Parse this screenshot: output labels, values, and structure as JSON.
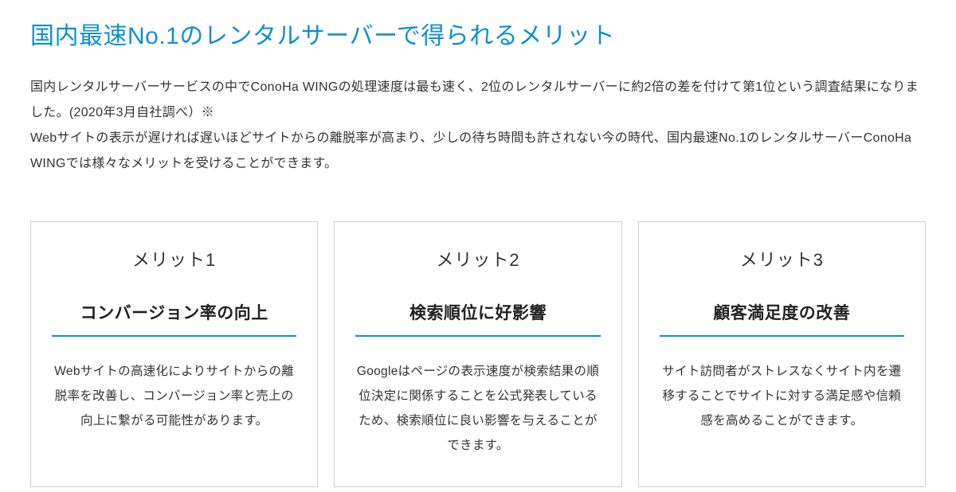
{
  "heading": "国内最速No.1のレンタルサーバーで得られるメリット",
  "intro": "国内レンタルサーバーサービスの中でConoHa WINGの処理速度は最も速く、2位のレンタルサーバーに約2倍の差を付けて第1位という調査結果になりました。(2020年3月自社調べ）※\nWebサイトの表示が遅ければ遅いほどサイトからの離脱率が高まり、少しの待ち時間も許されない今の時代、国内最速No.1のレンタルサーバーConoHa WINGでは様々なメリットを受けることができます。",
  "cards": [
    {
      "label": "メリット1",
      "title": "コンバージョン率の向上",
      "desc": "Webサイトの高速化によりサイトからの離脱率を改善し、コンバージョン率と売上の向上に繋がる可能性があります。"
    },
    {
      "label": "メリット2",
      "title": "検索順位に好影響",
      "desc": "Googleはページの表示速度が検索結果の順位決定に関係することを公式発表しているため、検索順位に良い影響を与えることができます。"
    },
    {
      "label": "メリット3",
      "title": "顧客満足度の改善",
      "desc": "サイト訪問者がストレスなくサイト内を遷移することでサイトに対する満足感や信頼感を高めることができます。"
    }
  ]
}
